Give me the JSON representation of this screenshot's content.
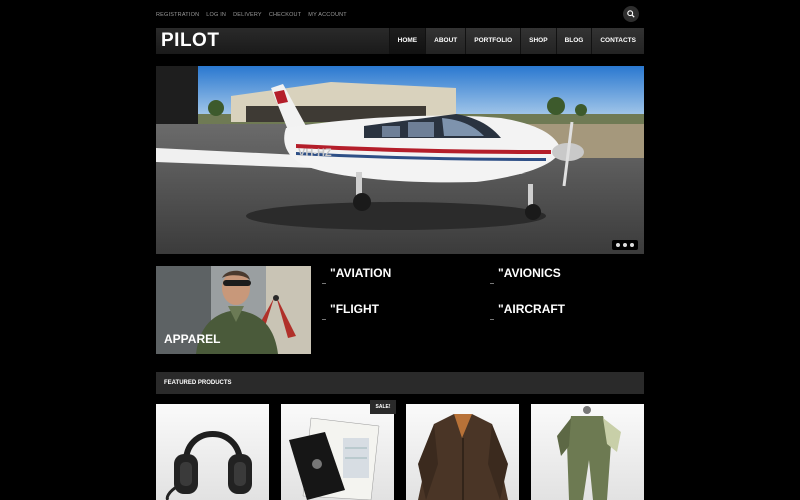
{
  "top_links": [
    "REGISTRATION",
    "LOG IN",
    "DELIVERY",
    "CHECKOUT",
    "MY ACCOUNT"
  ],
  "brand": {
    "logo": "PILOT"
  },
  "nav": [
    {
      "label": "HOME",
      "active": true
    },
    {
      "label": "ABOUT",
      "active": false
    },
    {
      "label": "PORTFOLIO",
      "active": false
    },
    {
      "label": "SHOP",
      "active": false
    },
    {
      "label": "BLOG",
      "active": false
    },
    {
      "label": "CONTACTS",
      "active": false
    }
  ],
  "hero": {
    "plane_reg": "VH-HZ",
    "slide_count": 3
  },
  "promo": {
    "label": "APPAREL"
  },
  "categories": [
    "\"AVIATION",
    "\"AVIONICS",
    "\"FLIGHT",
    "\"AIRCRAFT"
  ],
  "featured": {
    "title": "FEATURED PRODUCTS",
    "sale_badge": "SALE!"
  },
  "products": [
    "headset",
    "flight-kneeboard",
    "leather-jacket",
    "flight-suit"
  ],
  "colors": {
    "background": "#000000",
    "bar": "#2a2a2a",
    "text": "#ffffff",
    "muted": "#9a9a9a"
  }
}
